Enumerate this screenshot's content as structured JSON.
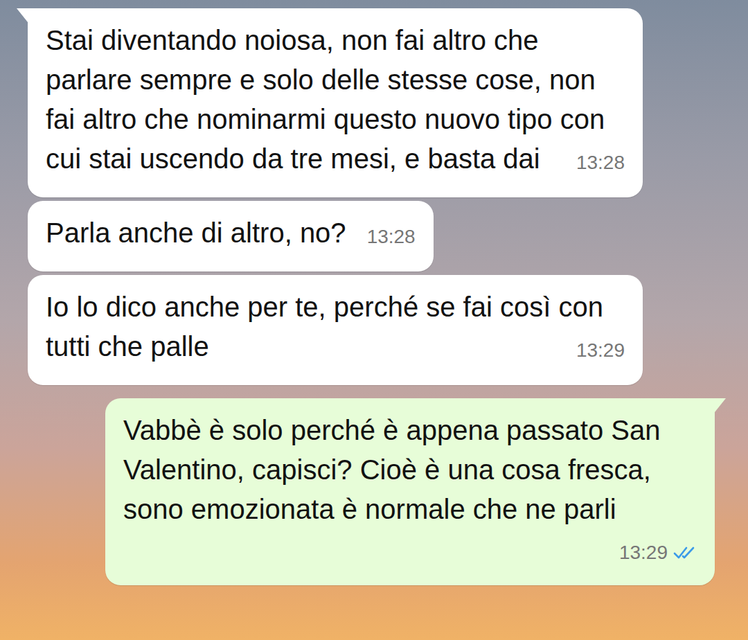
{
  "messages": [
    {
      "kind": "incoming",
      "tail": true,
      "text": "Stai diventando noiosa, non fai altro che parlare sempre e solo delle stesse cose, non fai altro che nominarmi questo nuovo tipo con cui stai uscendo da tre mesi, e basta dai",
      "time": "13:28",
      "read": false
    },
    {
      "kind": "incoming",
      "tail": false,
      "text": "Parla anche di altro, no?",
      "time": "13:28",
      "read": false
    },
    {
      "kind": "incoming",
      "tail": false,
      "text": "Io lo dico anche per te, perché se fai così con tutti che palle",
      "time": "13:29",
      "read": false
    },
    {
      "kind": "outgoing",
      "tail": true,
      "text": "Vabbè è solo perché è appena passato San Valentino, capisci? Cioè è una cosa fresca, sono emozionata è normale che ne parli",
      "time": "13:29",
      "read": true
    }
  ]
}
